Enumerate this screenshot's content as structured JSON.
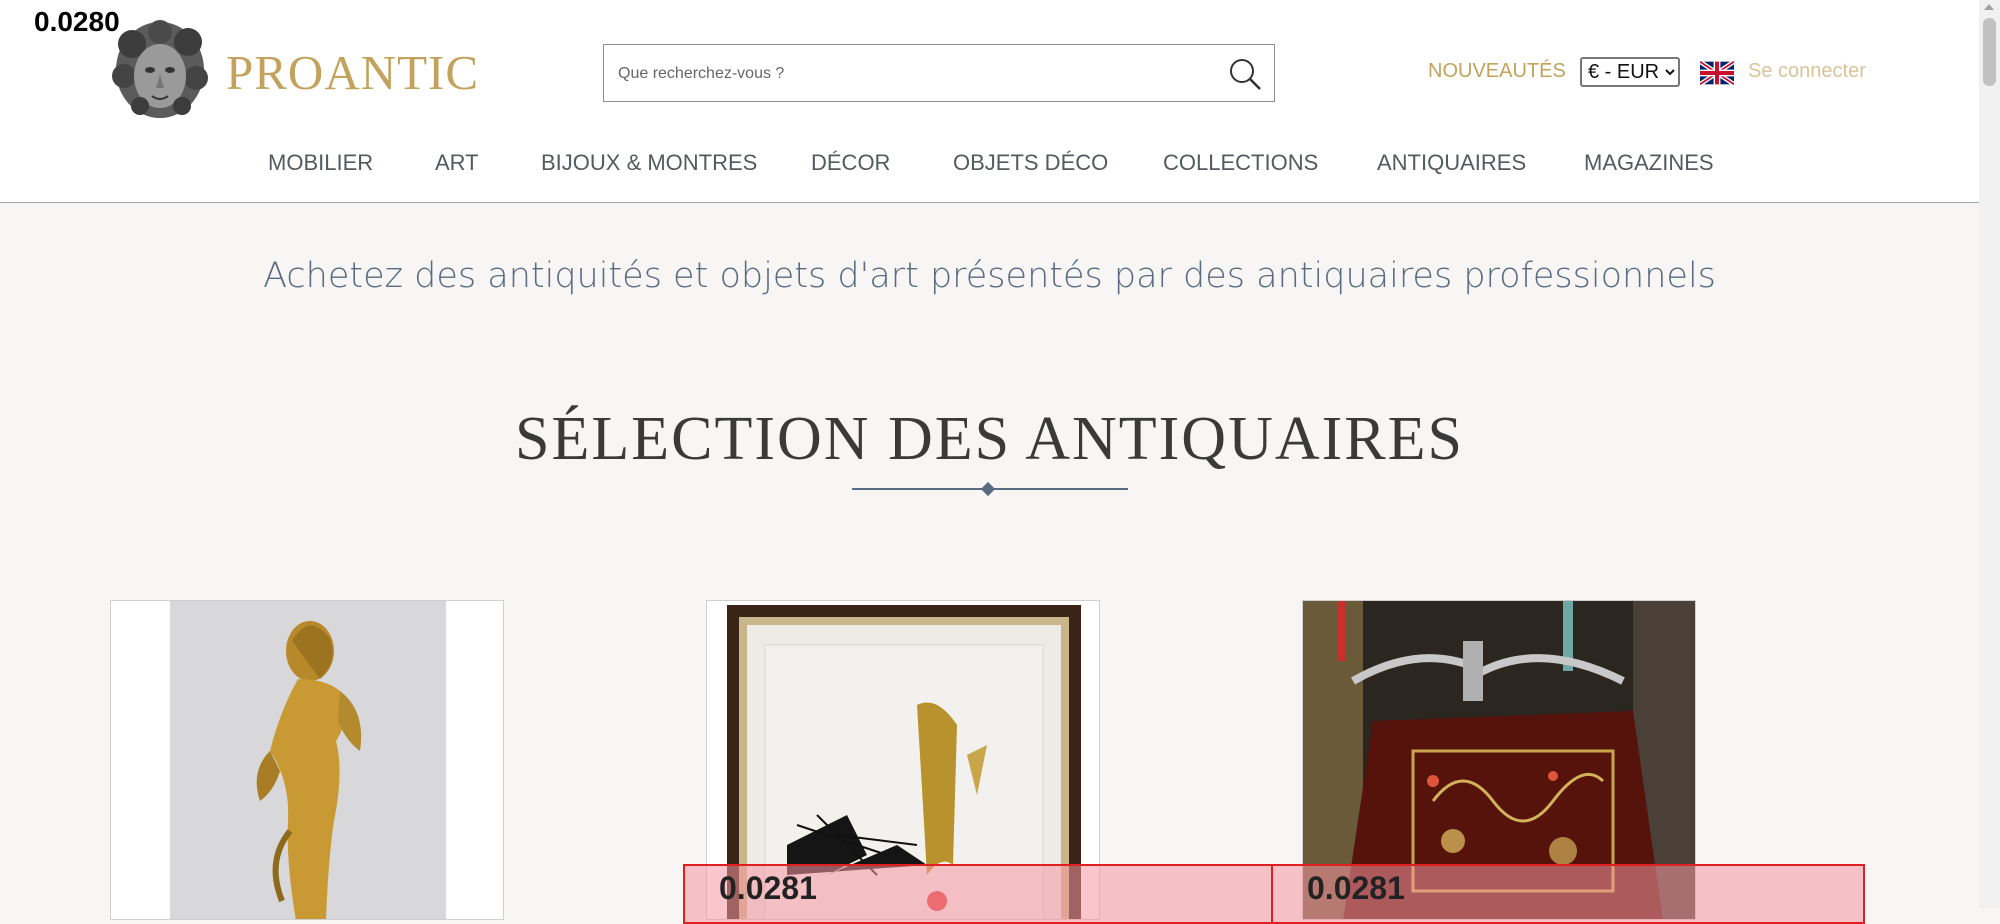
{
  "debug": {
    "top_label": "0.0280",
    "overlay_label": "0.0281"
  },
  "brand": {
    "name": "PROANTIC"
  },
  "search": {
    "placeholder": "Que recherchez-vous ?"
  },
  "topbar": {
    "new_label": "NOUVEAUTÉS",
    "currency_selected": "€ - EUR",
    "login_label": "Se connecter"
  },
  "nav": {
    "items": [
      {
        "label": "MOBILIER"
      },
      {
        "label": "ART"
      },
      {
        "label": "BIJOUX & MONTRES"
      },
      {
        "label": "DÉCOR"
      },
      {
        "label": "OBJETS DÉCO"
      },
      {
        "label": "COLLECTIONS"
      },
      {
        "label": "ANTIQUAIRES"
      },
      {
        "label": "MAGAZINES"
      }
    ]
  },
  "main": {
    "tagline": "Achetez des antiquités et objets d'art présentés par des antiquaires professionnels",
    "section_title": "SÉLECTION DES ANTIQUAIRES"
  },
  "colors": {
    "brand_gold": "#c2a25c",
    "heading_blue": "#5a6a80",
    "overlay_red": "#e02020"
  }
}
